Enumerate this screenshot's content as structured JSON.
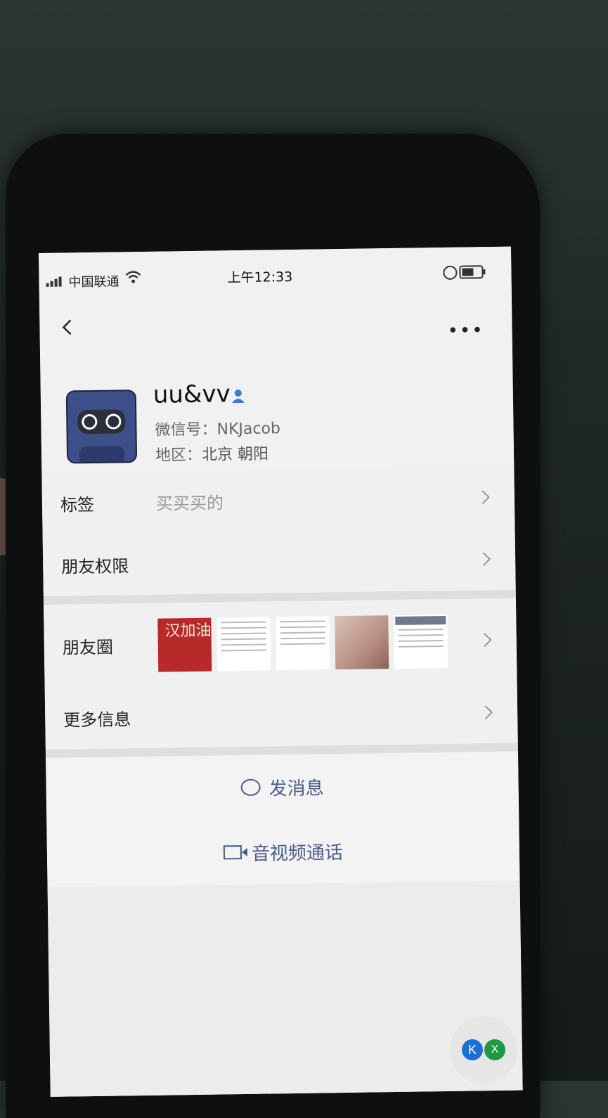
{
  "status_bar": {
    "carrier": "中国联通",
    "time": "上午12:33"
  },
  "profile": {
    "nickname": "uu&vv",
    "wechat_id": "微信号：NKJacob",
    "region_label": "地区：",
    "region_value": "北京 朝阳"
  },
  "rows": {
    "tags_label": "标签",
    "tags_value": "买买买的",
    "friend_perm_label": "朋友权限",
    "moments_label": "朋友圈",
    "more_info_label": "更多信息"
  },
  "moments_thumbs": {
    "slogan": "汉加油"
  },
  "actions": {
    "send_message": "发消息",
    "av_call": "音视频通话"
  },
  "widget": {
    "left_letter": "K",
    "right_letter": "X"
  },
  "colors": {
    "link_blue": "#4a5d88",
    "badge_blue": "#3a7bd5"
  }
}
